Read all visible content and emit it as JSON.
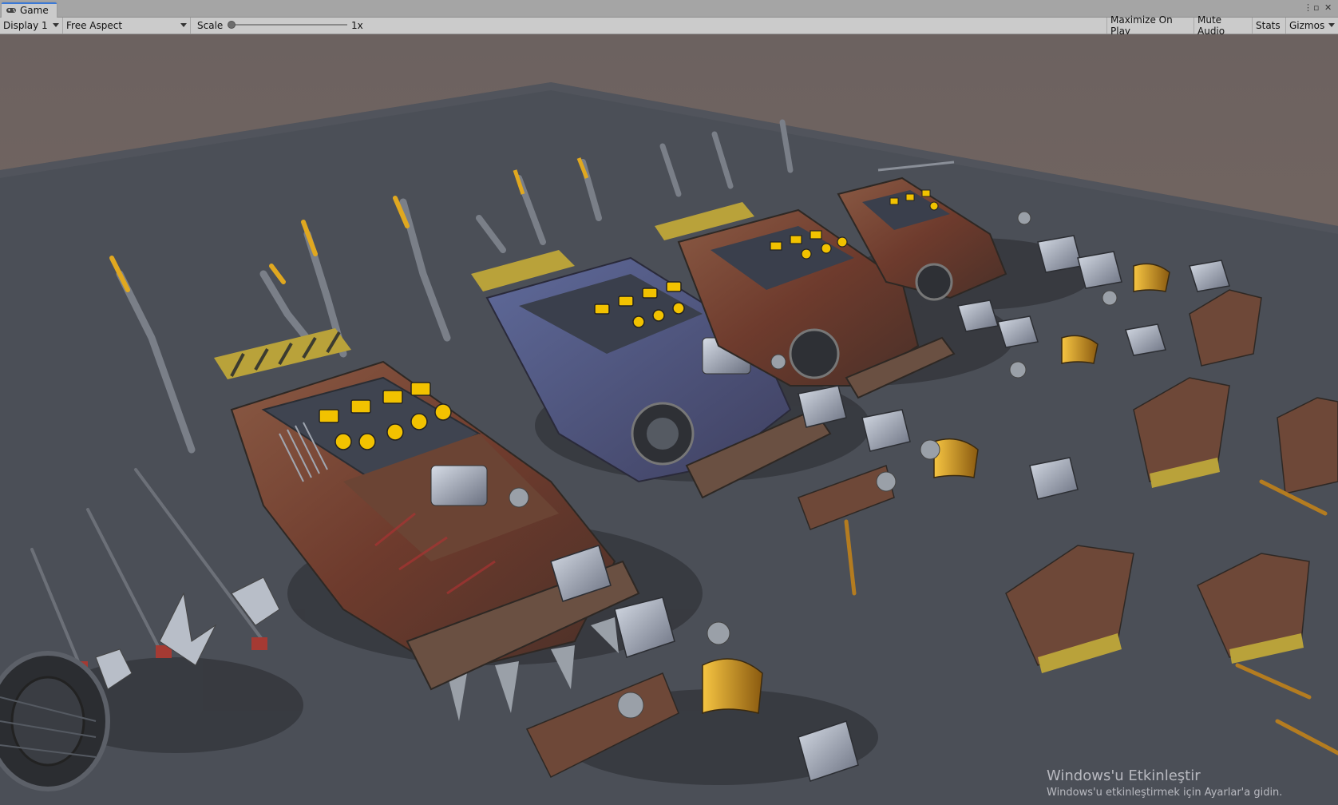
{
  "window": {
    "tab_label": "Game",
    "tab_icon": "gamepad-icon"
  },
  "toolbar": {
    "display": "Display 1",
    "aspect": "Free Aspect",
    "scale_label": "Scale",
    "scale_value": "1x",
    "scale_fraction": 0.0,
    "maximize_on_play": "Maximize On Play",
    "mute_audio": "Mute Audio",
    "stats": "Stats",
    "gizmos": "Gizmos"
  },
  "watermark": {
    "title": "Windows'u Etkinleştir",
    "subtitle": "Windows'u etkinleştirmek için Ayarlar'a gidin."
  },
  "colors": {
    "accent": "#3a79d8",
    "sky": "#7a6a63",
    "ground": "#4a4d55",
    "rust": "#7a4a35",
    "highlight_yellow": "#f2c200"
  }
}
